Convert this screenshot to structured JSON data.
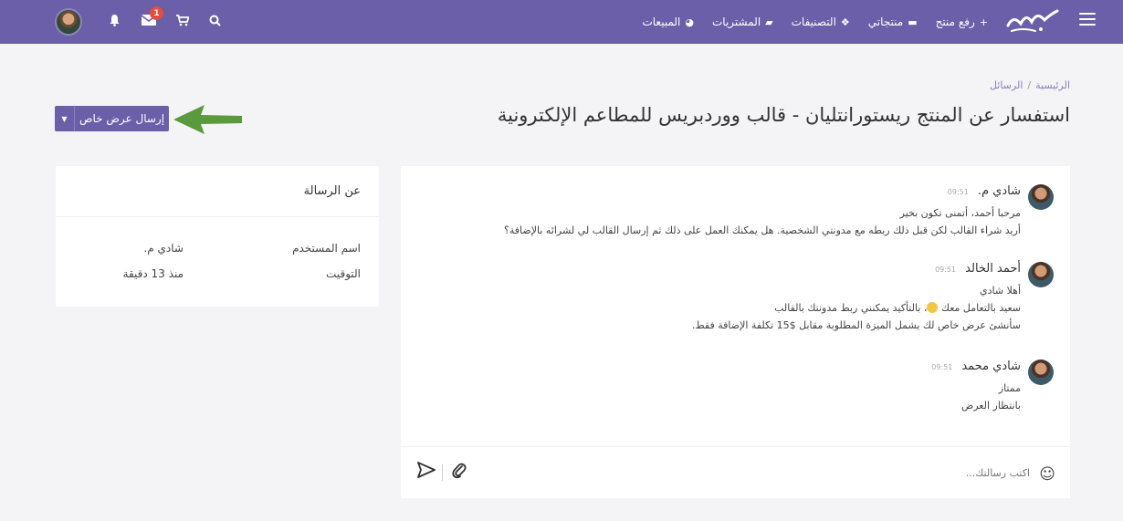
{
  "nav": {
    "logo_text": "بيكاليا",
    "items": [
      {
        "label": "رفع منتج",
        "icon": "plus-icon",
        "glyph": "+"
      },
      {
        "label": "منتجاتي",
        "icon": "briefcase-icon",
        "glyph": "▬"
      },
      {
        "label": "التصنيفات",
        "icon": "cubes-icon",
        "glyph": "❖"
      },
      {
        "label": "المشتريات",
        "icon": "folder-icon",
        "glyph": "▰"
      },
      {
        "label": "المبيعات",
        "icon": "pie-chart-icon",
        "glyph": "◕"
      }
    ],
    "mail_badge": "1"
  },
  "breadcrumb": {
    "home": "الرئيسية",
    "sep": "/",
    "current": "الرسائل"
  },
  "page_title": "استفسار عن المنتج ريستورانتليان - قالب ووردبريس للمطاعم الإلكترونية",
  "offer_button": {
    "label": "إرسال عرض خاص"
  },
  "messages": [
    {
      "name": "شادي م.",
      "time": "09:51",
      "lines": [
        "مرحبا أحمد، أتمنى تكون بخير",
        "أريد شراء القالب لكن قبل ذلك ربطه مع مدونتي الشخصية. هل يمكنك العمل على ذلك ثم إرسال القالب لي لشرائه بالإضافة؟"
      ]
    },
    {
      "name": "أحمد الخالد",
      "time": "09:51",
      "lines": [
        "أهلا شادي",
        "سعيد بالتعامل معك ، بالتأكيد يمكنني ربط مدونتك بالقالب",
        "سأنشئ عرض خاص لك يشمل الميزة المطلوبة مقابل $15 تكلفة الإضافة فقط."
      ]
    },
    {
      "name": "شادي محمد",
      "time": "09:51",
      "lines": [
        "ممتاز",
        "بانتظار العرض"
      ]
    }
  ],
  "composer": {
    "placeholder": "اكتب رسالتك..."
  },
  "info": {
    "title": "عن الرسالة",
    "rows": [
      {
        "key": "اسم المستخدم",
        "value": "شادي م."
      },
      {
        "key": "التوقيت",
        "value": "منذ 13 دقيقة"
      }
    ]
  },
  "colors": {
    "brand": "#6a5fa8",
    "arrow": "#5a9a3c",
    "badge": "#e74c3c"
  }
}
